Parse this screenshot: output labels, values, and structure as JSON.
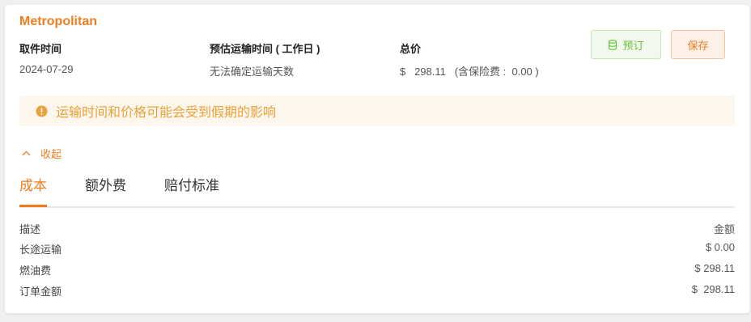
{
  "carrier": "Metropolitan",
  "info": [
    {
      "label": "取件时间",
      "value": "2024-07-29"
    },
    {
      "label": "预估运输时间 ( 工作日 )",
      "value": "无法确定运输天数"
    },
    {
      "label": "总价",
      "value": "$   298.11   (含保险费 :  0.00 )"
    }
  ],
  "buttons": {
    "book": "预订",
    "save": "保存"
  },
  "icons": {
    "book": "database-icon",
    "alert": "info-circle-icon",
    "collapse": "chevron-up-icon"
  },
  "alert": "运输时间和价格可能会受到假期的影响",
  "collapse_label": "收起",
  "tabs": [
    "成本",
    "额外费",
    "赔付标准"
  ],
  "active_tab": "成本",
  "table": {
    "headers": {
      "desc": "描述",
      "amount": "金额"
    },
    "rows": [
      {
        "desc": "长途运输",
        "amount": "$ 0.00"
      },
      {
        "desc": "燃油费",
        "amount": "$ 298.11"
      },
      {
        "desc": "订单金额",
        "amount": "$  298.11"
      }
    ]
  },
  "colors": {
    "accent": "#f07c1f",
    "success": "#67c23a",
    "warning": "#e6a23c"
  }
}
